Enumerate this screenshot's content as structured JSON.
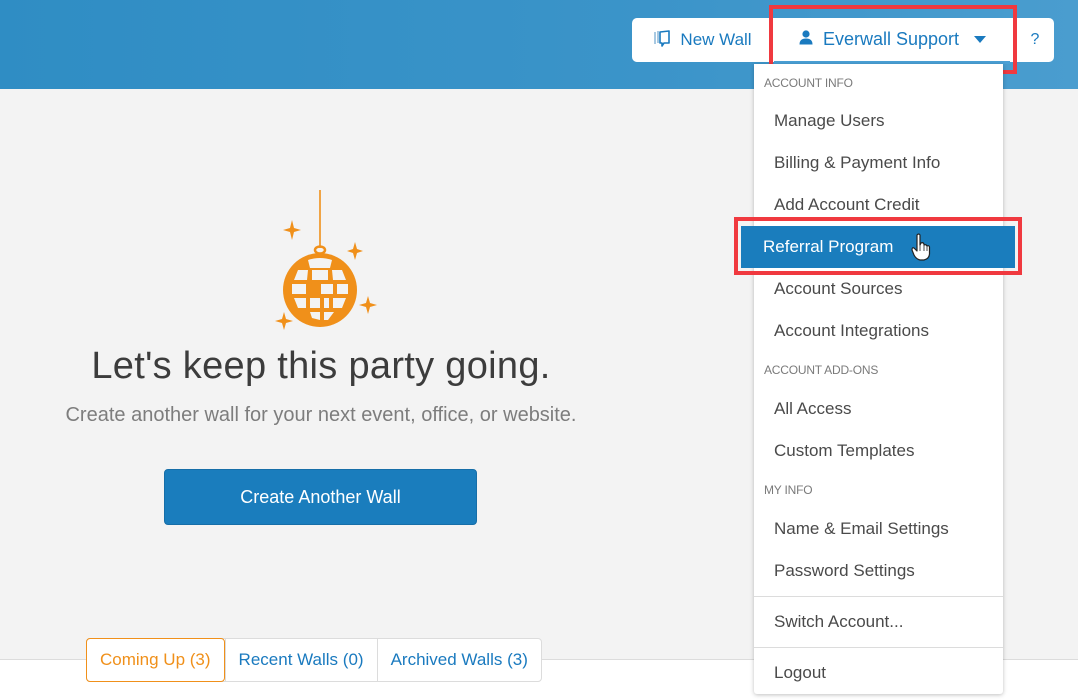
{
  "header": {
    "new_wall_label": "New Wall",
    "new_wall_icon": "walls-icon",
    "user_label": "Everwall Support",
    "user_icon": "user-icon",
    "help_label": "?"
  },
  "hero": {
    "illustration": "disco-ball-icon",
    "headline": "Let's keep this party going.",
    "subline": "Create another wall for your next event, office, or website.",
    "cta_label": "Create Another Wall"
  },
  "tabs": [
    {
      "label": "Coming Up (3)",
      "active": true
    },
    {
      "label": "Recent Walls (0)",
      "active": false
    },
    {
      "label": "Archived Walls (3)",
      "active": false
    }
  ],
  "dropdown": {
    "sections": {
      "account_info": "ACCOUNT INFO",
      "account_addons": "ACCOUNT ADD-ONS",
      "my_info": "MY INFO"
    },
    "items": {
      "manage_users": "Manage Users",
      "billing": "Billing & Payment Info",
      "add_credit": "Add Account Credit",
      "referral": "Referral Program",
      "sources": "Account Sources",
      "integrations": "Account Integrations",
      "all_access": "All Access",
      "custom_templates": "Custom Templates",
      "name_email": "Name & Email Settings",
      "password": "Password Settings",
      "switch_account": "Switch Account...",
      "logout": "Logout"
    },
    "highlighted": "Referral Program"
  },
  "colors": {
    "brand_blue": "#1a7dbd",
    "accent_orange": "#f0901a",
    "annotation_red": "#f0393f"
  }
}
